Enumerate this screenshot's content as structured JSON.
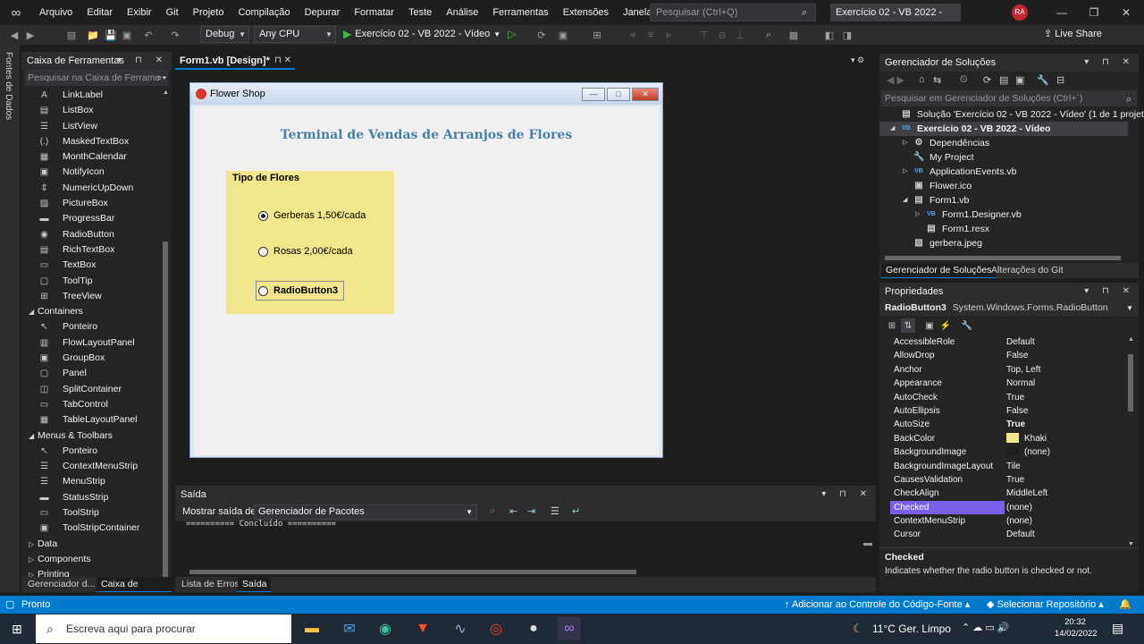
{
  "menu": [
    "Arquivo",
    "Editar",
    "Exibir",
    "Git",
    "Projeto",
    "Compilação",
    "Depurar",
    "Formatar",
    "Teste",
    "Análise",
    "Ferramentas",
    "Extensões",
    "Janela",
    "Ajuda"
  ],
  "top_search_placeholder": "Pesquisar (Ctrl+Q)",
  "solution_title": "Exercício 02 - VB 2022 - Vídeo",
  "user_initials": "RA",
  "toolbar": {
    "config": "Debug",
    "platform": "Any CPU",
    "run_target": "Exercício 02 - VB 2022 - Vídeo",
    "live_share": "Live Share"
  },
  "left_vertical_tab": "Fontes de Dados",
  "toolbox": {
    "title": "Caixa de Ferramentas",
    "search_placeholder": "Pesquisar na Caixa de Ferrame",
    "items": [
      {
        "label": "LinkLabel",
        "icon": "A",
        "cat": false
      },
      {
        "label": "ListBox",
        "icon": "▤",
        "cat": false
      },
      {
        "label": "ListView",
        "icon": "☰",
        "cat": false
      },
      {
        "label": "MaskedTextBox",
        "icon": "(.)",
        "cat": false
      },
      {
        "label": "MonthCalendar",
        "icon": "▦",
        "cat": false
      },
      {
        "label": "NotifyIcon",
        "icon": "▣",
        "cat": false
      },
      {
        "label": "NumericUpDown",
        "icon": "⇕",
        "cat": false
      },
      {
        "label": "PictureBox",
        "icon": "▨",
        "cat": false
      },
      {
        "label": "ProgressBar",
        "icon": "▬",
        "cat": false
      },
      {
        "label": "RadioButton",
        "icon": "◉",
        "cat": false
      },
      {
        "label": "RichTextBox",
        "icon": "▤",
        "cat": false
      },
      {
        "label": "TextBox",
        "icon": "▭",
        "cat": false
      },
      {
        "label": "ToolTip",
        "icon": "▢",
        "cat": false
      },
      {
        "label": "TreeView",
        "icon": "⊞",
        "cat": false
      },
      {
        "label": "Containers",
        "icon": "",
        "cat": true,
        "open": true
      },
      {
        "label": "Ponteiro",
        "icon": "↖",
        "cat": false
      },
      {
        "label": "FlowLayoutPanel",
        "icon": "▥",
        "cat": false
      },
      {
        "label": "GroupBox",
        "icon": "▣",
        "cat": false
      },
      {
        "label": "Panel",
        "icon": "▢",
        "cat": false
      },
      {
        "label": "SplitContainer",
        "icon": "◫",
        "cat": false
      },
      {
        "label": "TabControl",
        "icon": "▭",
        "cat": false
      },
      {
        "label": "TableLayoutPanel",
        "icon": "▦",
        "cat": false
      },
      {
        "label": "Menus & Toolbars",
        "icon": "",
        "cat": true,
        "open": true
      },
      {
        "label": "Ponteiro",
        "icon": "↖",
        "cat": false
      },
      {
        "label": "ContextMenuStrip",
        "icon": "☰",
        "cat": false
      },
      {
        "label": "MenuStrip",
        "icon": "☰",
        "cat": false
      },
      {
        "label": "StatusStrip",
        "icon": "▬",
        "cat": false
      },
      {
        "label": "ToolStrip",
        "icon": "▭",
        "cat": false
      },
      {
        "label": "ToolStripContainer",
        "icon": "▣",
        "cat": false
      },
      {
        "label": "Data",
        "icon": "",
        "cat": true,
        "open": false
      },
      {
        "label": "Components",
        "icon": "",
        "cat": true,
        "open": false
      },
      {
        "label": "Printing",
        "icon": "",
        "cat": true,
        "open": false
      }
    ],
    "bottom_tabs": [
      "Gerenciador d...",
      "Caixa de Ferra..."
    ]
  },
  "document_tab": "Form1.vb [Design]*",
  "form": {
    "title": "Flower Shop",
    "heading": "Terminal de Vendas de Arranjos de Flores",
    "group_title": "Tipo de Flores",
    "group_color": "#F0E68C",
    "radios": [
      {
        "label": "Gerberas 1,50€/cada",
        "checked": true
      },
      {
        "label": "Rosas 2,00€/cada",
        "checked": false
      },
      {
        "label": "RadioButton3",
        "checked": false
      }
    ]
  },
  "output": {
    "title": "Saída",
    "show_label": "Mostrar saída de:",
    "source": "Gerenciador de Pacotes",
    "text": "========== Concluído ==========",
    "bottom_tabs": [
      "Lista de Erros",
      "Saída"
    ]
  },
  "solution_explorer": {
    "title": "Gerenciador de Soluções",
    "search_placeholder": "Pesquisar em Gerenciador de Soluções (Ctrl+´)",
    "tree": [
      {
        "label": "Solução 'Exercício 02 - VB 2022 - Vídeo' (1 de 1 projeto)",
        "icon": "▤",
        "bold": false,
        "sel": false
      },
      {
        "label": "Exercício 02 - VB 2022 - Vídeo",
        "icon": "VB",
        "bold": true,
        "sel": true
      },
      {
        "label": "Dependências",
        "icon": "⚙",
        "bold": false,
        "sel": false
      },
      {
        "label": "My Project",
        "icon": "🔧",
        "bold": false,
        "sel": false
      },
      {
        "label": "ApplicationEvents.vb",
        "icon": "VB",
        "bold": false,
        "sel": false
      },
      {
        "label": "Flower.ico",
        "icon": "▣",
        "bold": false,
        "sel": false
      },
      {
        "label": "Form1.vb",
        "icon": "▤",
        "bold": false,
        "sel": false
      },
      {
        "label": "Form1.Designer.vb",
        "icon": "VB",
        "bold": false,
        "sel": false
      },
      {
        "label": "Form1.resx",
        "icon": "▤",
        "bold": false,
        "sel": false
      },
      {
        "label": "gerbera.jpeg",
        "icon": "▨",
        "bold": false,
        "sel": false
      }
    ],
    "bottom_tabs": [
      "Gerenciador de Soluções",
      "Alterações do Git"
    ]
  },
  "properties": {
    "title": "Propriedades",
    "object_name": "RadioButton3",
    "object_type": "System.Windows.Forms.RadioButton",
    "rows": [
      {
        "name": "AccessibleRole",
        "value": "Default"
      },
      {
        "name": "AllowDrop",
        "value": "False"
      },
      {
        "name": "Anchor",
        "value": "Top, Left"
      },
      {
        "name": "Appearance",
        "value": "Normal"
      },
      {
        "name": "AutoCheck",
        "value": "True"
      },
      {
        "name": "AutoEllipsis",
        "value": "False"
      },
      {
        "name": "AutoSize",
        "value": "True",
        "bold": true
      },
      {
        "name": "BackColor",
        "value": "Khaki",
        "swatch": "#F0E68C"
      },
      {
        "name": "BackgroundImage",
        "value": "(none)",
        "swatch": "#1e1e1e"
      },
      {
        "name": "BackgroundImageLayout",
        "value": "Tile"
      },
      {
        "name": "CausesValidation",
        "value": "True"
      },
      {
        "name": "CheckAlign",
        "value": "MiddleLeft"
      },
      {
        "name": "Checked",
        "value": "(none)",
        "sel": true
      },
      {
        "name": "ContextMenuStrip",
        "value": "(none)"
      },
      {
        "name": "Cursor",
        "value": "Default"
      }
    ],
    "desc_title": "Checked",
    "desc_text": "Indicates whether the radio button is checked or not."
  },
  "status": {
    "left": "Pronto",
    "source_control": "Adicionar ao Controle do Código-Fonte",
    "repo": "Selecionar Repositório"
  },
  "taskbar": {
    "search_placeholder": "Escreva aqui para procurar",
    "weather": "11°C  Ger. Limpo",
    "time": "20:32",
    "date": "14/02/2022"
  }
}
